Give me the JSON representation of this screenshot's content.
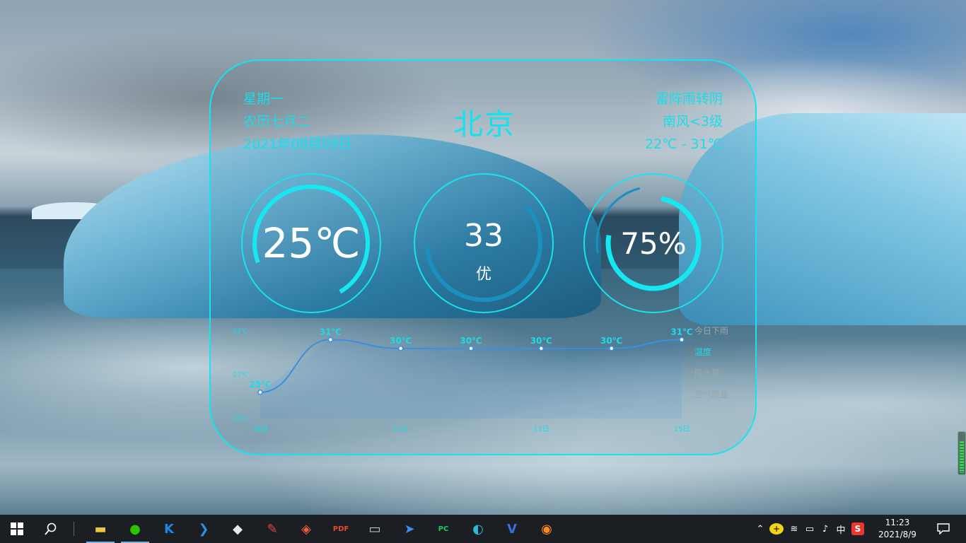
{
  "weather": {
    "city": "北京",
    "date_info": {
      "weekday": "星期一",
      "lunar": "农历七月二",
      "date": "2021年08月09日"
    },
    "condition": {
      "weather": "雷阵雨转阴",
      "wind": "南风<3级",
      "range": "22℃ - 31℃"
    },
    "gauges": {
      "temperature": {
        "value": "25℃",
        "fill": 0.72
      },
      "aqi": {
        "value": "33",
        "label": "优",
        "fill": 0.6
      },
      "humidity": {
        "value": "75%",
        "fill": 0.75
      }
    },
    "colors": {
      "accent": "#17e3ee",
      "line": "#3a8fe0",
      "ring_bg": "#1bb6d6",
      "ring_fg": "#16e8f2"
    },
    "legend": [
      "今日下雨",
      "温度",
      "降水量",
      "空气质量"
    ]
  },
  "chart_data": {
    "type": "line",
    "x": [
      "09日",
      "10日",
      "11日",
      "12日",
      "13日",
      "14日",
      "15日"
    ],
    "x_tick_labels": [
      "09日",
      "11日",
      "13日",
      "15日"
    ],
    "series": [
      {
        "name": "温度",
        "values": [
          25,
          31,
          30,
          30,
          30,
          30,
          31
        ],
        "labels": [
          "25℃",
          "31℃",
          "30℃",
          "30℃",
          "30℃",
          "30℃",
          "31℃"
        ]
      }
    ],
    "y_tick_labels": [
      "32℃",
      "27℃",
      "22℃"
    ],
    "ylim": [
      22,
      32
    ]
  },
  "taskbar": {
    "apps": [
      {
        "name": "file-explorer",
        "glyph": "▬",
        "color": "#f4c542",
        "active": true
      },
      {
        "name": "wechat",
        "glyph": "●",
        "color": "#2dc100",
        "active": true
      },
      {
        "name": "kugou",
        "glyph": "K",
        "color": "#1e88e5",
        "active": false
      },
      {
        "name": "vscode",
        "glyph": "❯",
        "color": "#2f8ee0",
        "active": false
      },
      {
        "name": "unity",
        "glyph": "◆",
        "color": "#e8e8e8",
        "active": false
      },
      {
        "name": "paint",
        "glyph": "✎",
        "color": "#e04848",
        "active": false
      },
      {
        "name": "wps",
        "glyph": "◈",
        "color": "#e85d3a",
        "active": false
      },
      {
        "name": "pdf",
        "glyph": "PDF",
        "color": "#e84a2e",
        "active": false
      },
      {
        "name": "terminal",
        "glyph": "▭",
        "color": "#cccccc",
        "active": false
      },
      {
        "name": "feishu",
        "glyph": "➤",
        "color": "#3a8ef0",
        "active": false
      },
      {
        "name": "pycharm",
        "glyph": "PC",
        "color": "#22c55e",
        "active": false
      },
      {
        "name": "edge",
        "glyph": "◐",
        "color": "#2fb7d8",
        "active": false
      },
      {
        "name": "visio",
        "glyph": "V",
        "color": "#3b6fd8",
        "active": false
      },
      {
        "name": "firefox",
        "glyph": "◉",
        "color": "#ff8a1c",
        "active": false
      }
    ],
    "tray": {
      "ime": "中",
      "sogou": "S"
    },
    "time": "11:23",
    "date": "2021/8/9"
  },
  "volume_meter": {
    "level": 0.8
  }
}
